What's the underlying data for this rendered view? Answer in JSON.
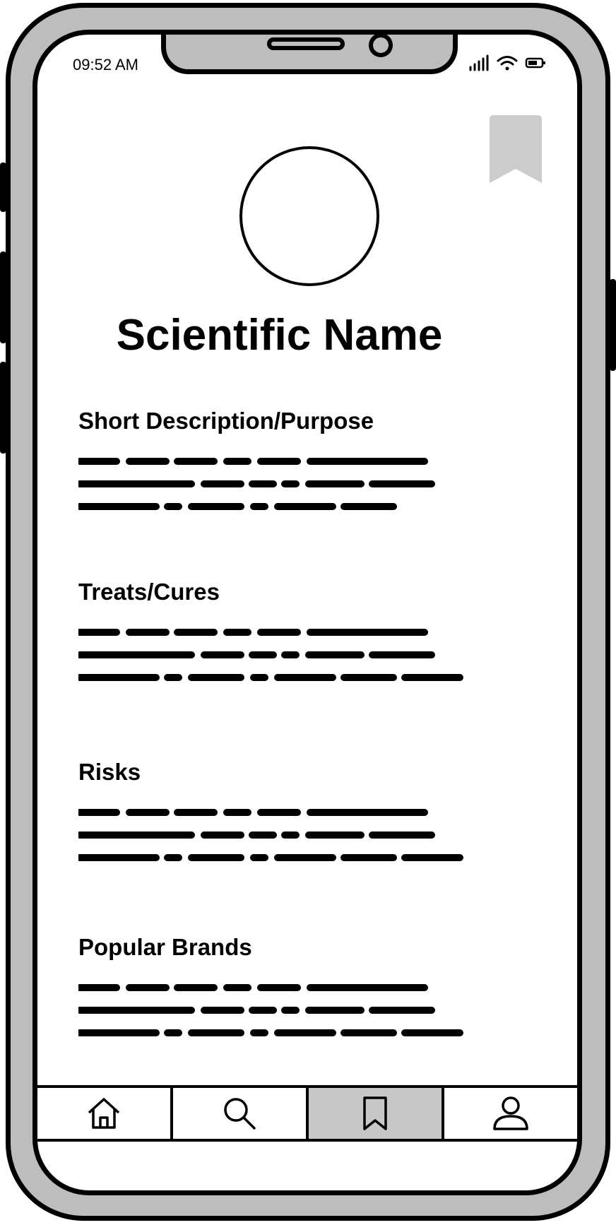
{
  "status_bar": {
    "time": "09:52 AM",
    "icons": [
      "signal-icon",
      "wifi-icon",
      "battery-icon"
    ]
  },
  "header": {
    "bookmark_icon": "bookmark-icon",
    "title": "Scientific Name"
  },
  "sections": [
    {
      "heading": "Short Description/Purpose"
    },
    {
      "heading": "Treats/Cures"
    },
    {
      "heading": "Risks"
    },
    {
      "heading": "Popular Brands"
    }
  ],
  "tab_bar": {
    "tabs": [
      {
        "icon": "home-icon",
        "active": false
      },
      {
        "icon": "search-icon",
        "active": false
      },
      {
        "icon": "bookmark-icon",
        "active": true
      },
      {
        "icon": "profile-icon",
        "active": false
      }
    ]
  },
  "colors": {
    "frame": "#bdbdbd",
    "outline": "#000000",
    "active_tab": "#c8c8c8",
    "bookmark_fill": "#cccccc"
  }
}
